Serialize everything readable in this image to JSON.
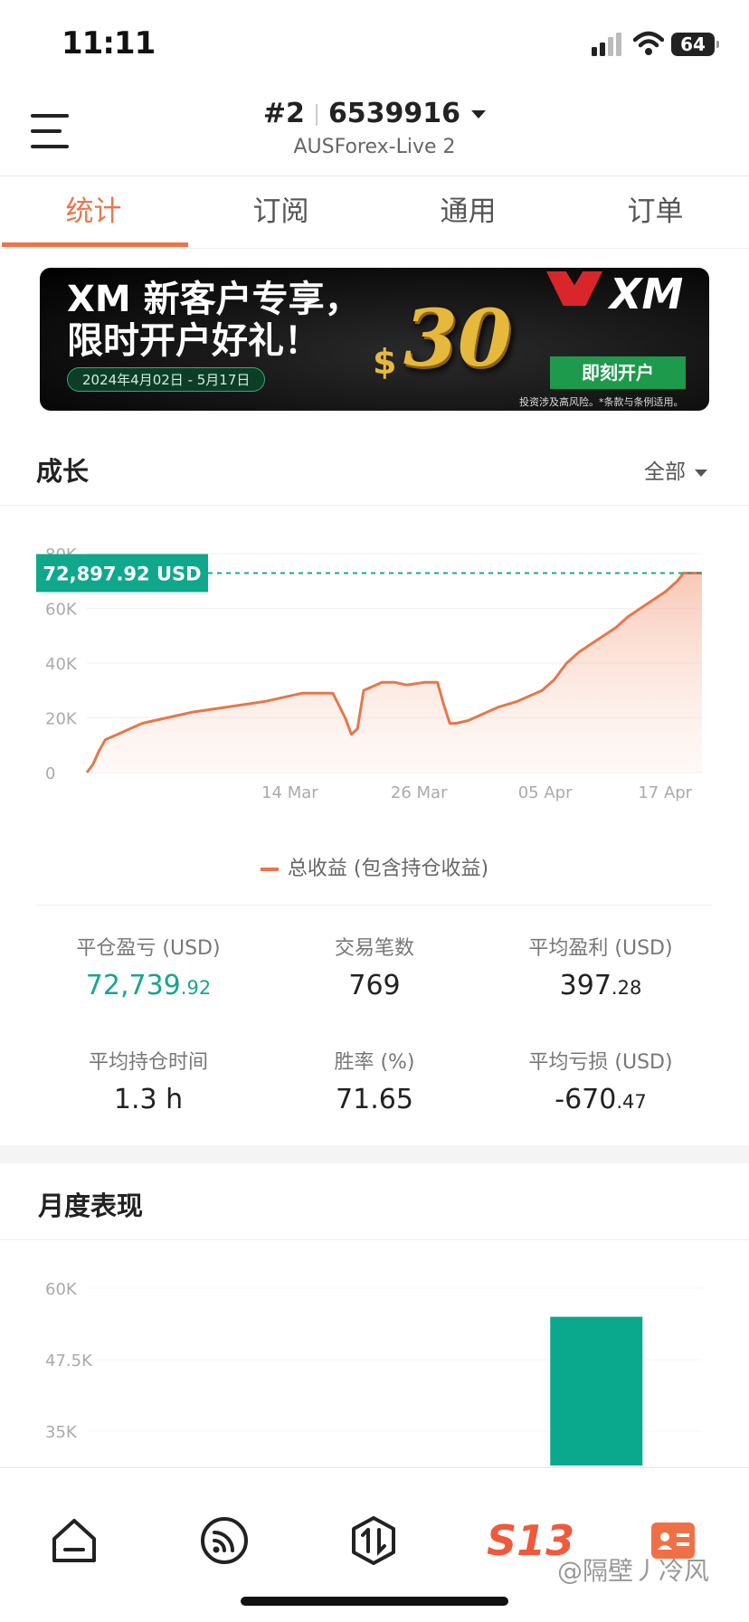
{
  "status_bar": {
    "time": "11:11",
    "battery": "64"
  },
  "header": {
    "account_index": "#2",
    "account_number": "6539916",
    "server": "AUSForex-Live 2"
  },
  "tabs": [
    {
      "label": "统计",
      "active": true
    },
    {
      "label": "订阅",
      "active": false
    },
    {
      "label": "通用",
      "active": false
    },
    {
      "label": "订单",
      "active": false
    }
  ],
  "banner": {
    "title_line1": "XM 新客户专享，",
    "title_line2": "限时开户好礼！",
    "date_range": "2024年4月02日 - 5月17日",
    "amount": "30",
    "currency_symbol": "$",
    "logo_text": "XM",
    "cta": "即刻开户",
    "disclaimer": "投资涉及高风险。*条款与条例适用。"
  },
  "growth": {
    "title": "成长",
    "filter": "全部",
    "current_value_label": "72,897.92 USD",
    "legend": "总收益 (包含持仓收益)"
  },
  "chart_data": [
    {
      "type": "area",
      "ylim": [
        0,
        80000
      ],
      "y_ticks": [
        "0",
        "20K",
        "40K",
        "60K",
        "80K"
      ],
      "x_ticks": [
        "14 Mar",
        "26 Mar",
        "05 Apr",
        "17 Apr"
      ],
      "x_tick_positions": [
        0.33,
        0.54,
        0.745,
        0.94
      ],
      "series": [
        {
          "name": "总收益 (包含持仓收益)",
          "color": "#e8764a",
          "x": [
            0,
            0.01,
            0.02,
            0.03,
            0.05,
            0.07,
            0.09,
            0.11,
            0.13,
            0.15,
            0.17,
            0.2,
            0.23,
            0.26,
            0.29,
            0.31,
            0.33,
            0.35,
            0.37,
            0.4,
            0.42,
            0.43,
            0.44,
            0.45,
            0.47,
            0.48,
            0.5,
            0.52,
            0.55,
            0.57,
            0.58,
            0.59,
            0.6,
            0.62,
            0.65,
            0.67,
            0.7,
            0.72,
            0.74,
            0.76,
            0.78,
            0.8,
            0.82,
            0.84,
            0.86,
            0.88,
            0.9,
            0.92,
            0.94,
            0.96,
            0.97,
            1.0
          ],
          "y": [
            0,
            3000,
            8000,
            12000,
            14000,
            16000,
            18000,
            19000,
            20000,
            21000,
            22000,
            23000,
            24000,
            25000,
            26000,
            27000,
            28000,
            29000,
            29000,
            29000,
            20000,
            14000,
            16000,
            30000,
            32000,
            33000,
            33000,
            32000,
            33000,
            33000,
            25000,
            18000,
            18000,
            19000,
            22000,
            24000,
            26000,
            28000,
            30000,
            34000,
            40000,
            44000,
            47000,
            50000,
            53000,
            57000,
            60000,
            63000,
            66000,
            70000,
            72898,
            72898
          ]
        }
      ],
      "current_value": 72897.92
    },
    {
      "type": "bar",
      "ylim": [
        30000,
        62000
      ],
      "y_ticks": [
        "35K",
        "47.5K",
        "60K"
      ],
      "y_tick_values": [
        35000,
        47500,
        60000
      ],
      "categories": [
        "",
        "",
        ""
      ],
      "values": [
        0,
        0,
        55000
      ],
      "color": "#0aa88c"
    }
  ],
  "stats": [
    {
      "label": "平仓盈亏 (USD)",
      "int": "72,739",
      "dec": ".92",
      "green": true
    },
    {
      "label": "交易笔数",
      "int": "769",
      "dec": "",
      "green": false
    },
    {
      "label": "平均盈利 (USD)",
      "int": "397",
      "dec": ".28",
      "green": false
    },
    {
      "label": "平均持仓时间",
      "int": "1.3 h",
      "dec": "",
      "green": false
    },
    {
      "label": "胜率 (%)",
      "int": "71.65",
      "dec": "",
      "green": false
    },
    {
      "label": "平均亏损 (USD)",
      "int": "-670",
      "dec": ".47",
      "green": false
    }
  ],
  "monthly": {
    "title": "月度表现"
  },
  "nav": {
    "center_label": "S13"
  },
  "watermark": "@隔壁丿冷风",
  "colors": {
    "accent": "#e8764a",
    "green": "#0aa88c",
    "text": "#222222"
  }
}
